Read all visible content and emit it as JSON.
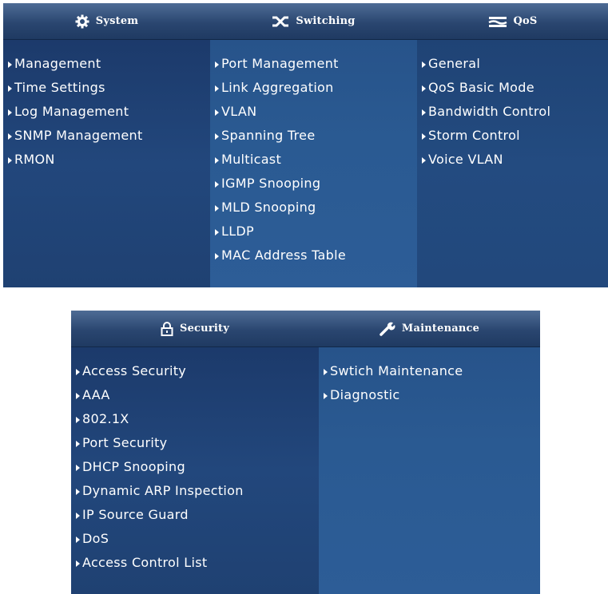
{
  "top_panel": {
    "headers": [
      {
        "label": "System",
        "icon": "gear-icon"
      },
      {
        "label": "Switching",
        "icon": "switch-arrows-icon"
      },
      {
        "label": "QoS",
        "icon": "qos-lines-icon"
      }
    ],
    "columns": [
      [
        "Management",
        "Time Settings",
        "Log Management",
        "SNMP Management",
        "RMON"
      ],
      [
        "Port Management",
        "Link Aggregation",
        "VLAN",
        "Spanning Tree",
        "Multicast",
        "IGMP Snooping",
        "MLD Snooping",
        "LLDP",
        "MAC Address Table"
      ],
      [
        "General",
        "QoS Basic Mode",
        "Bandwidth Control",
        "Storm Control",
        "Voice VLAN"
      ]
    ]
  },
  "bottom_panel": {
    "headers": [
      {
        "label": "Security",
        "icon": "lock-icon"
      },
      {
        "label": "Maintenance",
        "icon": "wrench-icon"
      }
    ],
    "columns": [
      [
        "Access Security",
        "AAA",
        "802.1X",
        "Port Security",
        "DHCP Snooping",
        "Dynamic ARP Inspection",
        "IP Source Guard",
        "DoS",
        "Access Control List"
      ],
      [
        "Swtich Maintenance",
        "Diagnostic"
      ]
    ]
  },
  "colors": {
    "header_top": "#4e6c95",
    "header_bottom": "#1f3a62",
    "menu_dark": "#1c3a6b",
    "menu_light": "#2d5d97",
    "text": "#ffffff"
  }
}
